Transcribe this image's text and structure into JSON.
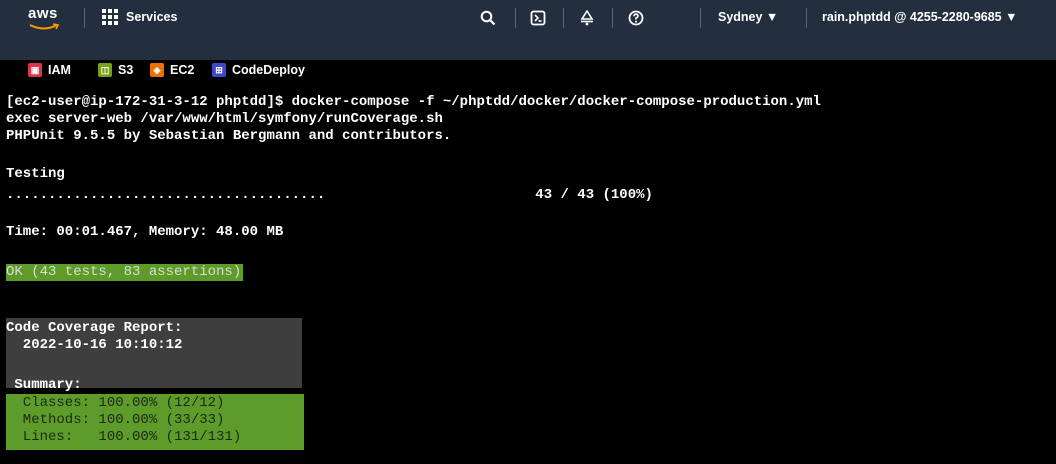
{
  "header": {
    "logo_text": "aws",
    "services_label": "Services",
    "region_label": "Sydney ▼",
    "account_label": "rain.phptdd @ 4255-2280-9685 ▼",
    "icons": [
      "search-icon",
      "cloudshell-icon",
      "notifications-icon",
      "help-icon"
    ]
  },
  "favorites": [
    {
      "label": "IAM",
      "icon_color": "#dd344c"
    },
    {
      "label": "S3",
      "icon_color": "#7aa116"
    },
    {
      "label": "EC2",
      "icon_color": "#ed7100"
    },
    {
      "label": "CodeDeploy",
      "icon_color": "#3f48cc"
    }
  ],
  "terminal": {
    "lines": [
      "[ec2-user@ip-172-31-3-12 phptdd]$ docker-compose -f ~/phptdd/docker/docker-compose-production.yml",
      "exec server-web /var/www/html/symfony/runCoverage.sh",
      "PHPUnit 9.5.5 by Sebastian Bergmann and contributors.",
      "",
      "Testing",
      "......................................                         43 / 43 (100%)",
      "",
      "Time: 00:01.467, Memory: 48.00 MB"
    ],
    "ok_line": "OK (43 tests, 83 assertions)",
    "coverage_title": "Code Coverage Report:",
    "coverage_date": "  2022-10-16 10:10:12",
    "summary_label": " Summary:",
    "summary_lines": [
      "  Classes: 100.00% (12/12)",
      "  Methods: 100.00% (33/33)",
      "  Lines:   100.00% (131/131)"
    ]
  }
}
